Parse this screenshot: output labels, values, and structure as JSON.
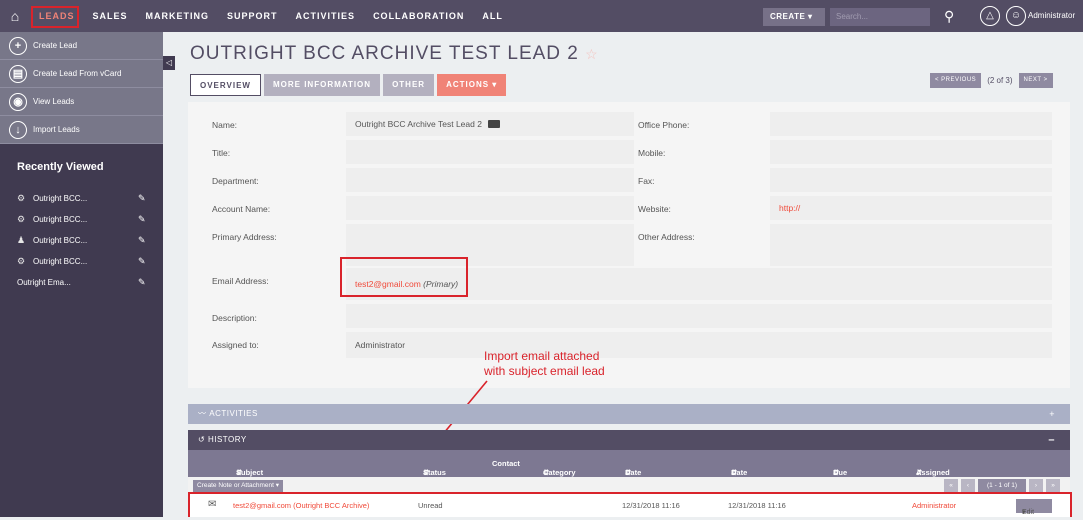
{
  "nav": {
    "items": [
      "LEADS",
      "SALES",
      "MARKETING",
      "SUPPORT",
      "ACTIVITIES",
      "COLLABORATION",
      "ALL"
    ],
    "create_label": "CREATE",
    "search_placeholder": "Search...",
    "user": "Administrator"
  },
  "sidebar": {
    "actions": [
      "Create Lead",
      "Create Lead From vCard",
      "View Leads",
      "Import Leads"
    ],
    "recent_title": "Recently Viewed",
    "recent": [
      "Outright BCC...",
      "Outright BCC...",
      "Outright BCC...",
      "Outright BCC...",
      "Outright Ema..."
    ]
  },
  "record": {
    "title": "OUTRIGHT BCC ARCHIVE TEST LEAD 2",
    "tabs": [
      "OVERVIEW",
      "MORE INFORMATION",
      "OTHER",
      "ACTIONS"
    ],
    "pager": {
      "prev": "< PREVIOUS",
      "count": "(2 of 3)",
      "next": "NEXT >"
    }
  },
  "fields": {
    "name_label": "Name:",
    "name_value": "Outright BCC Archive Test Lead 2",
    "title_label": "Title:",
    "department_label": "Department:",
    "account_label": "Account Name:",
    "primary_address_label": "Primary Address:",
    "email_label": "Email Address:",
    "email_value": "test2@gmail.com",
    "email_primary": "(Primary)",
    "description_label": "Description:",
    "assigned_label": "Assigned to:",
    "assigned_value": "Administrator",
    "office_phone_label": "Office Phone:",
    "mobile_label": "Mobile:",
    "fax_label": "Fax:",
    "website_label": "Website:",
    "website_value": "http://",
    "other_address_label": "Other Address:"
  },
  "annotation": {
    "line1": "Import email attached",
    "line2": "with subject email lead"
  },
  "subpanels": {
    "activities": "ACTIVITIES",
    "history": "HISTORY",
    "columns": [
      "Subject",
      "Status",
      "Contact",
      "Category",
      "Date Modified",
      "Date Created",
      "Due Date",
      "Assigned User"
    ],
    "create_note": "Create Note or Attachment",
    "page_count": "(1 - 1 of 1)",
    "row": {
      "subject": "test2@gmail.com (Outright BCC Archive)",
      "status": "Unread",
      "date_modified": "12/31/2018 11:16",
      "date_created": "12/31/2018 11:16",
      "assigned": "Administrator",
      "edit": "Edit"
    }
  },
  "colors": {
    "nav_bg": "#534d64",
    "accent": "#f08377",
    "highlight": "#d9232b",
    "sidebar_bg": "#403a50"
  }
}
